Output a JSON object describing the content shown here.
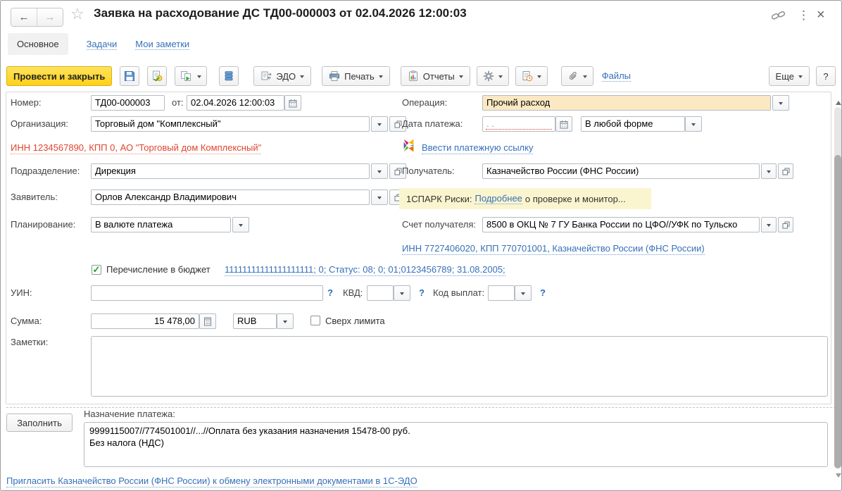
{
  "icons": {
    "back": "←",
    "forward": "→",
    "star": "☆",
    "kebab": "⋮",
    "close": "×",
    "check": "✓",
    "question": "?"
  },
  "window": {
    "title": "Заявка на расходование ДС ТД00-000003 от 02.04.2026 12:00:03"
  },
  "tabs": [
    {
      "label": "Основное"
    },
    {
      "label": "Задачи"
    },
    {
      "label": "Мои заметки"
    }
  ],
  "toolbar": {
    "post_and_close": "Провести и закрыть",
    "edo": "ЭДО",
    "print": "Печать",
    "reports": "Отчеты",
    "files": "Файлы",
    "more": "Еще",
    "help": "?"
  },
  "form": {
    "number": {
      "label": "Номер:",
      "value": "ТД00-000003"
    },
    "doc_date": {
      "label": "от:",
      "value": "02.04.2026 12:00:03"
    },
    "operation": {
      "label": "Операция:",
      "value": "Прочий расход"
    },
    "organization": {
      "label": "Организация:",
      "value": "Торговый дом \"Комплексный\"",
      "details_link": "ИНН 1234567890, КПП 0, АО \"Торговый дом Комплексный\""
    },
    "payment_date": {
      "label": "Дата платежа:",
      "value": "",
      "placeholder": ".  .",
      "form_value": "В любой форме"
    },
    "payment_link_label": "Ввести платежную ссылку",
    "department": {
      "label": "Подразделение:",
      "value": "Дирекция"
    },
    "recipient": {
      "label": "Получатель:",
      "value": "Казначейство России (ФНС России)",
      "details_link": "ИНН 7727406020, КПП 770701001, Казначейство России (ФНС России)"
    },
    "applicant": {
      "label": "Заявитель:",
      "value": "Орлов Александр Владимирович"
    },
    "spark": {
      "prefix": "1СПАРК Риски:",
      "link": "Подробнее",
      "suffix": "о проверке и монитор..."
    },
    "planning": {
      "label": "Планирование:",
      "value": "В валюте платежа"
    },
    "recipient_account": {
      "label": "Счет получателя:",
      "value": "8500 в ОКЦ № 7 ГУ Банка России по ЦФО//УФК по Тульско"
    },
    "budget_transfer": {
      "label": "Перечисление в бюджет",
      "checked": true,
      "details_link": "11111111111111111111; 0; Статус: 08; 0; 01;0123456789; 31.08.2005;"
    },
    "uin": {
      "label": "УИН:",
      "value": ""
    },
    "kvd": {
      "label": "КВД:",
      "value": ""
    },
    "payout_code": {
      "label": "Код выплат:",
      "value": ""
    },
    "amount": {
      "label": "Сумма:",
      "value": "15 478,00",
      "currency": "RUB",
      "over_limit_label": "Сверх лимита"
    },
    "notes": {
      "label": "Заметки:",
      "value": ""
    }
  },
  "footer": {
    "fill_button": "Заполнить",
    "purpose_label": "Назначение платежа:",
    "purpose_value": "9999115007//774501001//...//Оплата без указания назначения 15478-00 руб.\nБез налога (НДС)",
    "invite_link": "Пригласить Казначейство России (ФНС России) к обмену электронными документами в 1С-ЭДО"
  },
  "colors": {
    "accent_yellow": "#ffd21e",
    "operation_field_bg": "#fbe9c4",
    "spark_band_bg": "#fbf5cf",
    "link_blue": "#3670b9",
    "error_red": "#e0442e"
  }
}
